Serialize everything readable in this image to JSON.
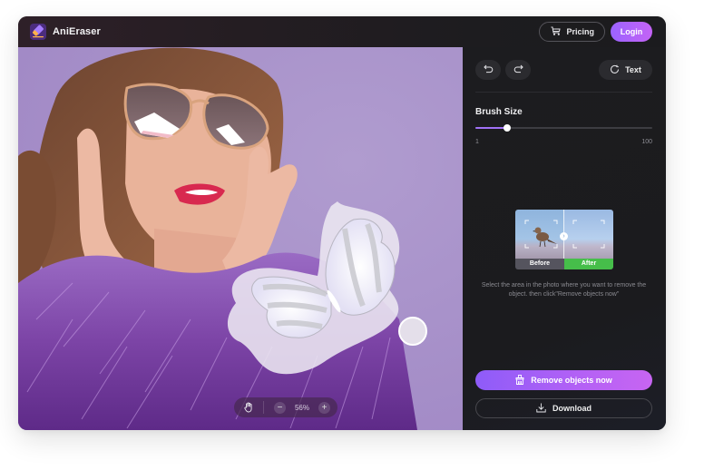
{
  "app": {
    "name": "AniEraser",
    "icons": {
      "logo": "eraser-logo-icon"
    }
  },
  "header": {
    "pricing_label": "Pricing",
    "pricing_icon": "cart-icon",
    "login_label": "Login"
  },
  "canvas": {
    "zoom_level": "56%",
    "zoom_in_label": "+",
    "zoom_out_label": "−",
    "icons": {
      "pan": "hand-icon",
      "brush_cursor": "brush-cursor-circle"
    },
    "colors": {
      "background": "#a890c8",
      "selection_overlay": "#e8e3ee"
    }
  },
  "panel": {
    "undo_icon": "undo-icon",
    "redo_icon": "redo-icon",
    "text_button_label": "Text",
    "text_button_icon": "refresh-text-icon",
    "brush_size": {
      "label": "Brush Size",
      "min": 1,
      "max": 100,
      "min_label": "1",
      "max_label": "100",
      "value": 19
    },
    "demo": {
      "before_label": "Before",
      "after_label": "After",
      "arrow_label": "›"
    },
    "hint": "Select the area in the photo where you want to remove the object. then click\"Remove objects now\"",
    "remove_button_label": "Remove objects now",
    "remove_button_icon": "brush-clean-icon",
    "download_button_label": "Download",
    "download_button_icon": "download-icon"
  },
  "colors": {
    "accent_start": "#8e5cf8",
    "accent_end": "#c765f2",
    "panel_bg": "#1b1b1e",
    "after_green": "#46be4a"
  }
}
